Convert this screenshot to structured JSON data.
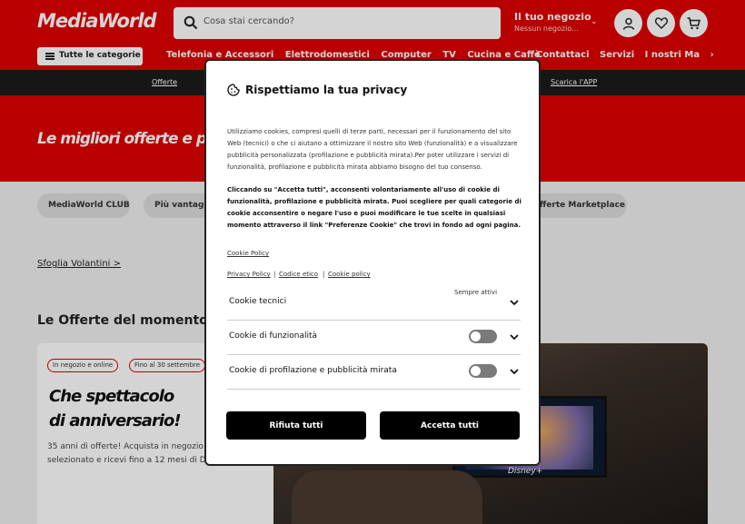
{
  "header": {
    "logo": "MediaWorld",
    "search_placeholder": "Cosa stai cercando?",
    "store_title": "Il tuo negozio",
    "store_sub": "Nessun negozio...",
    "categories_button": "Tutte le categorie",
    "nav": [
      "Telefonia e Accessori",
      "Elettrodomestici",
      "Computer",
      "TV",
      "Cucina e Caffè"
    ],
    "nav_right": [
      "Contattaci",
      "Servizi",
      "I nostri Ma"
    ]
  },
  "subbar": {
    "left": "Offerte",
    "right": "Scarica l'APP"
  },
  "banner": {
    "title": "Le migliori offerte e prom"
  },
  "pills": [
    "MediaWorld CLUB",
    "Più vantagg",
    "fferte Marketplace"
  ],
  "sfoglia": "Sfoglia Volantini >",
  "offers": {
    "heading": "Le Offerte del momento",
    "tags": [
      "In negozio e online",
      "Fino al 30 settembre"
    ],
    "title_line1": "Che spettacolo",
    "title_line2": "di anniversario!",
    "desc_line1": "35 anni di offerte! Acquista in negozio",
    "desc_line2": "selezionato e ricevi fino a 12 mesi di D",
    "photo_brand": "Disney+"
  },
  "cookie_modal": {
    "title": "Rispettiamo la tua privacy",
    "p1_lines": [
      "Utilizziamo cookies, compresi quelli di terze parti, necessari per il funzionamento del sito",
      "Web (tecnici) o che ci aiutano a ottimizzare il nostro sito Web (funzionalità) e a visualizzare",
      "pubblicità personalizzata (profilazione e pubblicità mirata).Per poter utilizzare i servizi di",
      "funzionalità, profilazione e pubblicità mirata abbiamo bisogno del tuo consenso."
    ],
    "p2_lines": [
      "Cliccando su \"Accetta tutti\", acconsenti volontariamente all'uso di cookie di",
      "funzionalità, profilazione e pubblicità mirata. Puoi scegliere per quali categorie di",
      "cookie acconsentire o negare l'uso e puoi modificare le tue scelte in qualsiasi",
      "momento attraverso il link \"Preferenze Cookie\" che trovi in fondo ad ogni pagina."
    ],
    "cookie_policy_link": "Cookie Policy",
    "privacy_link": "Privacy Policy",
    "etico_link": "Codice etico",
    "cookie_policy_link2": "Cookie policy",
    "separator": "|",
    "rows": [
      {
        "label": "Cookie tecnici",
        "status": "Sempre attivi",
        "toggle": null
      },
      {
        "label": "Cookie di funzionalità",
        "status": "",
        "toggle": false
      },
      {
        "label": "Cookie di profilazione e pubblicità mirata",
        "status": "",
        "toggle": false
      }
    ],
    "reject_button": "Rifiuta tutti",
    "accept_button": "Accetta tutti"
  }
}
